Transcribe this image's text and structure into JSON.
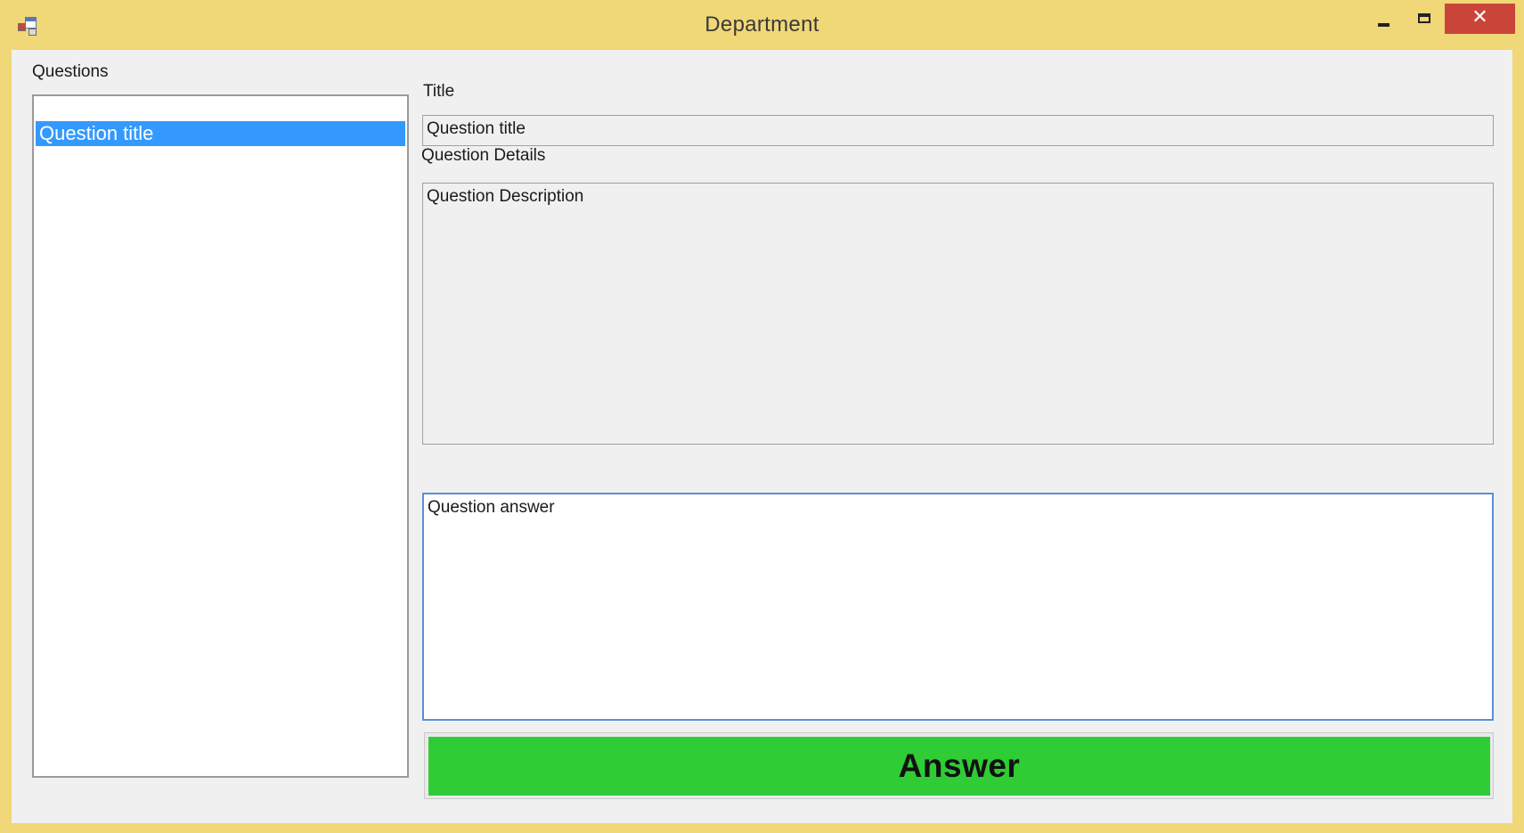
{
  "window": {
    "title": "Department",
    "icon": "app-window-icon",
    "controls": {
      "minimize": "minimize-icon",
      "maximize": "maximize-icon",
      "close": "close-icon"
    },
    "frame_color": "#f0d777"
  },
  "questions_panel": {
    "label": "Questions",
    "items": [
      {
        "label": "Question title",
        "selected": true
      }
    ]
  },
  "title_field": {
    "label": "Title",
    "value": "Question title"
  },
  "details_field": {
    "label": "Question Details",
    "value": "Question Description"
  },
  "answer_field": {
    "value": "Question answer"
  },
  "answer_button": {
    "label": "Answer",
    "color": "#2fcc35"
  },
  "colors": {
    "selection": "#3399ff",
    "close_button": "#c9453a"
  }
}
